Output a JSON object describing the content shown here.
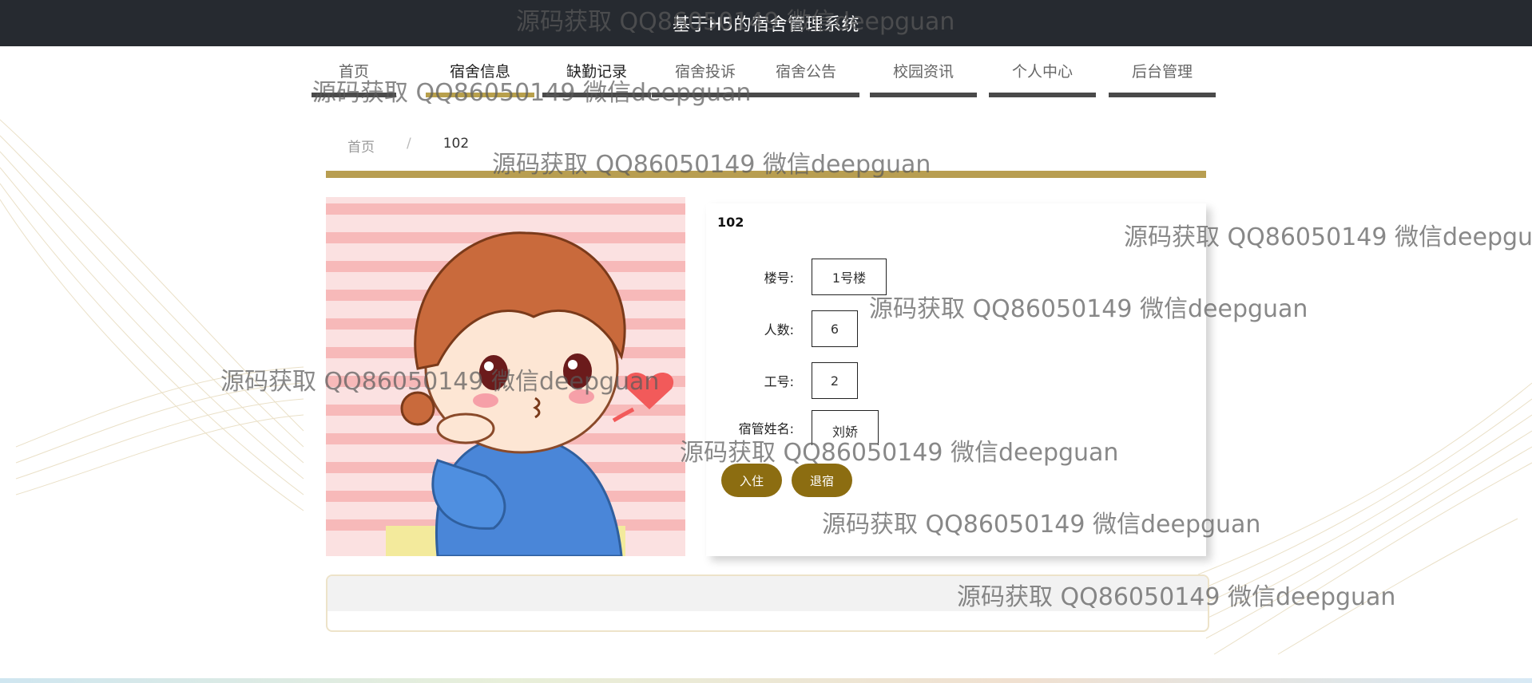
{
  "header": {
    "title": "基于H5的宿舍管理系统"
  },
  "nav": {
    "items": [
      {
        "label": "首页"
      },
      {
        "label": "宿舍信息"
      },
      {
        "label": "缺勤记录"
      },
      {
        "label": "宿舍投诉"
      },
      {
        "label": "宿舍公告"
      },
      {
        "label": "校园资讯"
      },
      {
        "label": "个人中心"
      },
      {
        "label": "后台管理"
      }
    ],
    "active_index": 1
  },
  "breadcrumb": {
    "home": "首页",
    "separator": "/",
    "current": "102"
  },
  "detail": {
    "title": "102",
    "fields": [
      {
        "label": "楼号:",
        "value": "1号楼"
      },
      {
        "label": "人数:",
        "value": "6"
      },
      {
        "label": "工号:",
        "value": "2"
      },
      {
        "label": "宿管姓名:",
        "value": "刘娇"
      }
    ],
    "buttons": {
      "checkin": "入住",
      "checkout": "退宿"
    }
  },
  "watermark": {
    "text": "源码获取 QQ86050149 微信deepguan"
  },
  "colors": {
    "accent_gold": "#b89e51",
    "button_brown": "#8c6d11",
    "topbar": "#262a30"
  }
}
